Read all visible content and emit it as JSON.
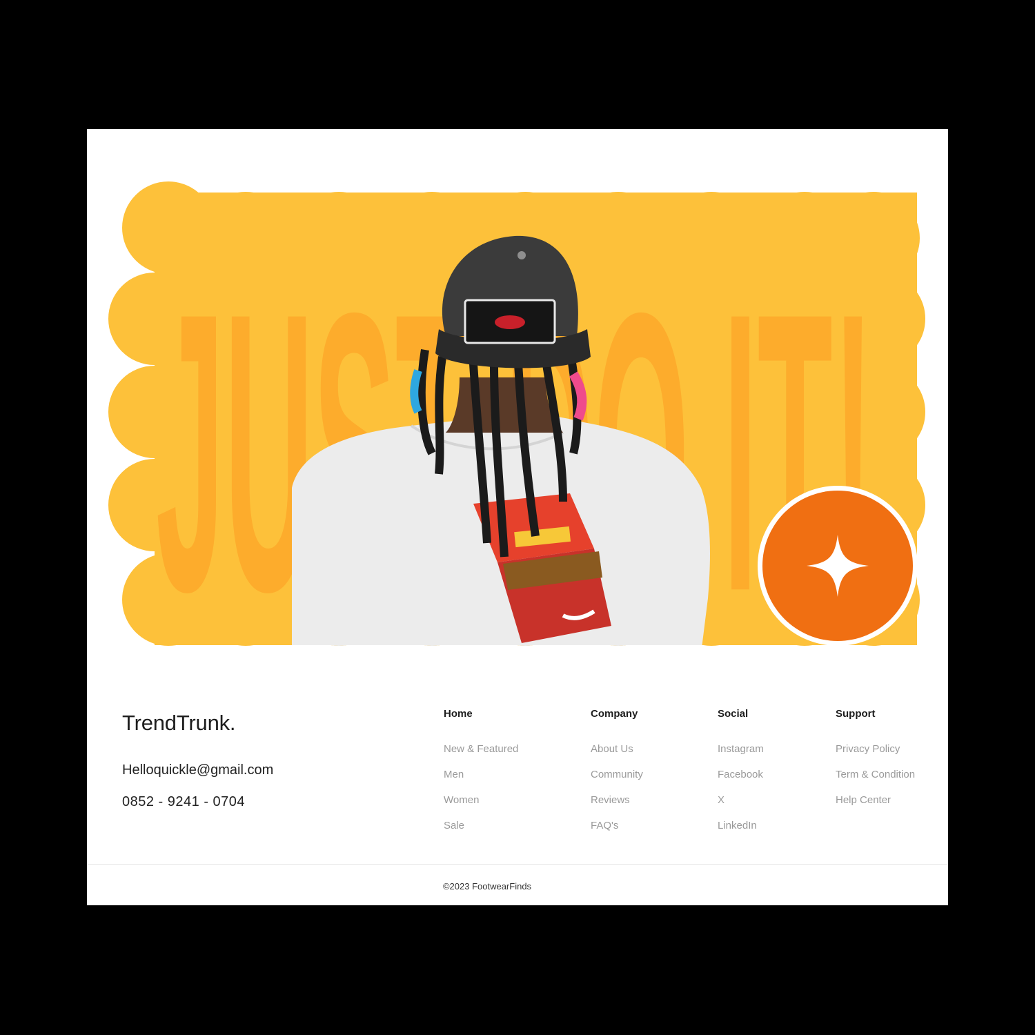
{
  "hero": {
    "headline": "JUST DO IT!",
    "badge_icon": "sparkle-star-icon",
    "colors": {
      "yellow": "#fdc13a",
      "deep_yellow": "#fdac2c",
      "orange": "#f06f12"
    },
    "image": "person-back-view-photo"
  },
  "brand": {
    "name": "TrendTrunk."
  },
  "contact": {
    "email": "Helloquickle@gmail.com",
    "phone": "0852 - 9241 - 0704"
  },
  "footer_columns": [
    {
      "title": "Home",
      "links": [
        "New & Featured",
        "Men",
        "Women",
        "Sale"
      ]
    },
    {
      "title": "Company",
      "links": [
        "About Us",
        "Community",
        "Reviews",
        "FAQ's"
      ]
    },
    {
      "title": "Social",
      "links": [
        "Instagram",
        "Facebook",
        "X",
        "LinkedIn"
      ]
    },
    {
      "title": "Support",
      "links": [
        "Privacy Policy",
        "Term & Condition",
        "Help Center"
      ]
    }
  ],
  "copyright": "©2023 FootwearFinds"
}
